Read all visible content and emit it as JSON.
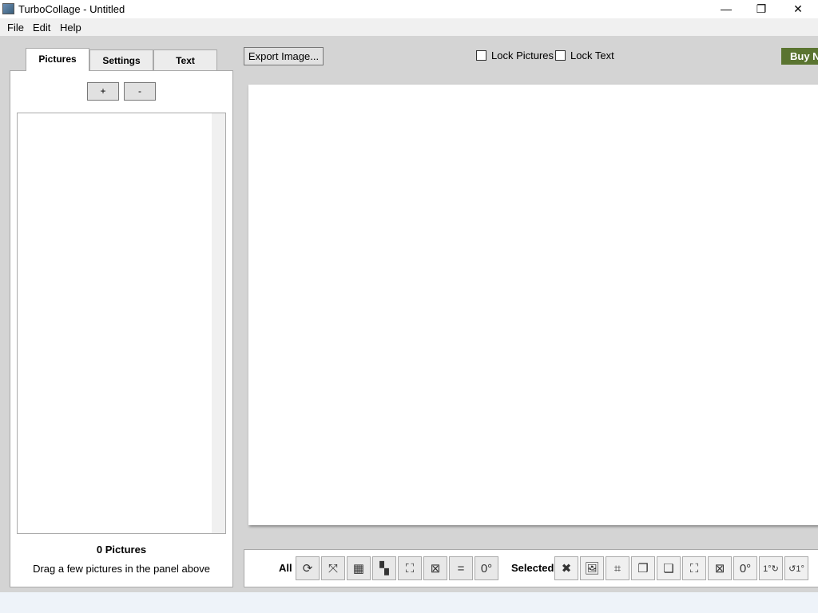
{
  "window": {
    "title": "TurboCollage - Untitled",
    "minimize": "—",
    "maximize": "❐",
    "close": "✕"
  },
  "menu": [
    "File",
    "Edit",
    "Help"
  ],
  "tabs": [
    {
      "label": "Pictures",
      "active": true
    },
    {
      "label": "Settings"
    },
    {
      "label": "Text"
    }
  ],
  "pictures": {
    "add": "+",
    "remove": "-",
    "count": "0 Pictures",
    "hint": "Drag a few pictures in the panel above"
  },
  "top": {
    "export": "Export Image...",
    "lock_pictures": "Lock Pictures",
    "lock_text": "Lock Text",
    "buy": "Buy Now",
    "buy_color": "#5a7430"
  },
  "toolbar": {
    "all_label": "All",
    "all_icons": [
      {
        "name": "shuffle-icon",
        "glyph": "⟳"
      },
      {
        "name": "spread-icon",
        "glyph": "⤧"
      },
      {
        "name": "grid-icon",
        "glyph": "▦"
      },
      {
        "name": "mosaic-icon",
        "glyph": "▚"
      },
      {
        "name": "expand-icon",
        "glyph": "⛶"
      },
      {
        "name": "shrink-icon",
        "glyph": "⊠"
      },
      {
        "name": "equal-size-icon",
        "glyph": "="
      },
      {
        "name": "rotate-zero-icon",
        "glyph": "0°"
      }
    ],
    "selected_label": "Selected",
    "selected_icons": [
      {
        "name": "delete-icon",
        "glyph": "✖"
      },
      {
        "name": "image-icon",
        "glyph": "🖼"
      },
      {
        "name": "crop-icon",
        "glyph": "⌗"
      },
      {
        "name": "bring-front-icon",
        "glyph": "❐"
      },
      {
        "name": "send-back-icon",
        "glyph": "❏"
      },
      {
        "name": "expand-icon",
        "glyph": "⛶"
      },
      {
        "name": "shrink-icon",
        "glyph": "⊠"
      },
      {
        "name": "rotate-zero-icon",
        "glyph": "0°"
      },
      {
        "name": "rotate-cw-icon",
        "glyph": "1°↻"
      },
      {
        "name": "rotate-ccw-icon",
        "glyph": "↺1°"
      }
    ]
  }
}
